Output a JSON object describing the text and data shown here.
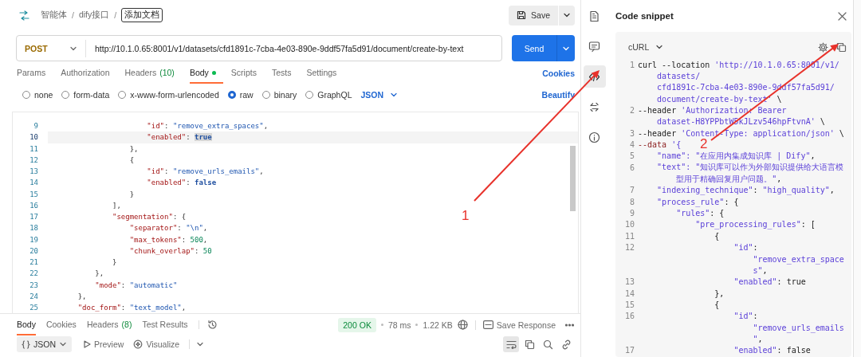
{
  "breadcrumb": [
    {
      "kind": "crumb",
      "text": "智能体"
    },
    {
      "kind": "separator",
      "text": "/"
    },
    {
      "kind": "crumb",
      "text": "dify接口"
    },
    {
      "kind": "separator",
      "text": "/"
    },
    {
      "kind": "editing",
      "text": "添加文档"
    }
  ],
  "save_button": {
    "label": "Save"
  },
  "request": {
    "method": "POST",
    "url": "http://10.1.0.65:8001/v1/datasets/cfd1891c-7cba-4e03-890e-9ddf57fa5d91/document/create-by-text",
    "send_label": "Send"
  },
  "request_tabs": [
    {
      "label": "Params",
      "selected": false,
      "indicator": false
    },
    {
      "label": "Authorization",
      "selected": false,
      "indicator": false
    },
    {
      "label": "Headers",
      "count": "(10)",
      "selected": false,
      "indicator": false
    },
    {
      "label": "Body",
      "selected": true,
      "indicator": true
    },
    {
      "label": "Scripts",
      "selected": false,
      "indicator": false
    },
    {
      "label": "Tests",
      "selected": false,
      "indicator": false
    },
    {
      "label": "Settings",
      "selected": false,
      "indicator": false
    }
  ],
  "cookies_link": "Cookies",
  "body_types": [
    {
      "label": "none",
      "selected": false
    },
    {
      "label": "form-data",
      "selected": false
    },
    {
      "label": "x-www-form-urlencoded",
      "selected": false
    },
    {
      "label": "raw",
      "selected": true
    },
    {
      "label": "binary",
      "selected": false
    },
    {
      "label": "GraphQL",
      "selected": false
    }
  ],
  "body_language": "JSON",
  "beautify_link": "Beautify",
  "editor": {
    "lines": [
      {
        "number": "9",
        "current": false,
        "tokens": [
          {
            "kind": "key",
            "text": "                    \"id\""
          },
          {
            "kind": "punct",
            "text": ": "
          },
          {
            "kind": "string",
            "text": "\"remove_extra_spaces\""
          },
          {
            "kind": "punct",
            "text": ","
          }
        ]
      },
      {
        "number": "10",
        "current": true,
        "tokens": [
          {
            "kind": "key",
            "text": "                    \"enabled\""
          },
          {
            "kind": "punct",
            "text": ": "
          },
          {
            "kind": "occurrence",
            "text": "true"
          }
        ]
      },
      {
        "number": "11",
        "current": false,
        "tokens": [
          {
            "kind": "punct",
            "text": "                },"
          }
        ]
      },
      {
        "number": "12",
        "current": false,
        "tokens": [
          {
            "kind": "punct",
            "text": "                {"
          }
        ]
      },
      {
        "number": "13",
        "current": false,
        "tokens": [
          {
            "kind": "key",
            "text": "                    \"id\""
          },
          {
            "kind": "punct",
            "text": ": "
          },
          {
            "kind": "string",
            "text": "\"remove_urls_emails\""
          },
          {
            "kind": "punct",
            "text": ","
          }
        ]
      },
      {
        "number": "14",
        "current": false,
        "tokens": [
          {
            "kind": "key",
            "text": "                    \"enabled\""
          },
          {
            "kind": "punct",
            "text": ": "
          },
          {
            "kind": "bool",
            "text": "false"
          }
        ]
      },
      {
        "number": "15",
        "current": false,
        "tokens": [
          {
            "kind": "punct",
            "text": "                }"
          }
        ]
      },
      {
        "number": "16",
        "current": false,
        "tokens": [
          {
            "kind": "punct",
            "text": "            ],"
          }
        ]
      },
      {
        "number": "17",
        "current": false,
        "tokens": [
          {
            "kind": "key",
            "text": "            \"segmentation\""
          },
          {
            "kind": "punct",
            "text": ": {"
          }
        ]
      },
      {
        "number": "18",
        "current": false,
        "tokens": [
          {
            "kind": "key",
            "text": "                \"separator\""
          },
          {
            "kind": "punct",
            "text": ": "
          },
          {
            "kind": "string",
            "text": "\"\\n\""
          },
          {
            "kind": "punct",
            "text": ","
          }
        ]
      },
      {
        "number": "19",
        "current": false,
        "tokens": [
          {
            "kind": "key",
            "text": "                \"max_tokens\""
          },
          {
            "kind": "punct",
            "text": ": "
          },
          {
            "kind": "number",
            "text": "500"
          },
          {
            "kind": "punct",
            "text": ","
          }
        ]
      },
      {
        "number": "20",
        "current": false,
        "tokens": [
          {
            "kind": "key",
            "text": "                \"chunk_overlap\""
          },
          {
            "kind": "punct",
            "text": ": "
          },
          {
            "kind": "number",
            "text": "50"
          }
        ]
      },
      {
        "number": "21",
        "current": false,
        "tokens": [
          {
            "kind": "punct",
            "text": "            }"
          }
        ]
      },
      {
        "number": "22",
        "current": false,
        "tokens": [
          {
            "kind": "punct",
            "text": "        },"
          }
        ]
      },
      {
        "number": "23",
        "current": false,
        "tokens": [
          {
            "kind": "key",
            "text": "        \"mode\""
          },
          {
            "kind": "punct",
            "text": ": "
          },
          {
            "kind": "string",
            "text": "\"automatic\""
          }
        ]
      },
      {
        "number": "24",
        "current": false,
        "tokens": [
          {
            "kind": "punct",
            "text": "    },"
          }
        ]
      },
      {
        "number": "25",
        "current": false,
        "tokens": [
          {
            "kind": "key",
            "text": "    \"doc_form\""
          },
          {
            "kind": "punct",
            "text": ": "
          },
          {
            "kind": "string",
            "text": "\"text_model\""
          },
          {
            "kind": "punct",
            "text": ","
          }
        ]
      }
    ]
  },
  "response_tabs": [
    {
      "label": "Body",
      "selected": true
    },
    {
      "label": "Cookies",
      "selected": false
    },
    {
      "label": "Headers",
      "count": "(8)",
      "selected": false
    },
    {
      "label": "Test Results",
      "selected": false
    }
  ],
  "response_status": {
    "code": "200 OK",
    "time": "78 ms",
    "size": "1.22 KB",
    "save_label": "Save Response"
  },
  "response_view": {
    "format": "JSON",
    "preview": "Preview",
    "visualize": "Visualize",
    "wrap_lines": true
  },
  "side_rail": [
    {
      "kind": "document",
      "selected": false
    },
    {
      "kind": "comment",
      "selected": false
    },
    {
      "kind": "code",
      "selected": true
    },
    {
      "kind": "sync",
      "selected": false
    },
    {
      "kind": "info",
      "selected": false
    }
  ],
  "code_snippet": {
    "title": "Code snippet",
    "language": "cURL",
    "lines": [
      {
        "number": "1",
        "rows": [
          {
            "segments": [
              {
                "kind": "plain",
                "text": "curl --location "
              },
              {
                "kind": "string",
                "text": "'http://10.1.0.65:8001/v1/"
              }
            ]
          },
          {
            "segments": [
              {
                "kind": "string",
                "text": "    datasets/"
              }
            ]
          },
          {
            "segments": [
              {
                "kind": "string",
                "text": "    cfd1891c-7cba-4e03-890e-9ddf57fa5d91/"
              }
            ]
          },
          {
            "segments": [
              {
                "kind": "string",
                "text": "    document/create-by-text'"
              },
              {
                "kind": "plain",
                "text": " \\"
              }
            ]
          }
        ]
      },
      {
        "number": "2",
        "rows": [
          {
            "segments": [
              {
                "kind": "plain",
                "text": "--header "
              },
              {
                "kind": "string",
                "text": "'Authorization: Bearer"
              }
            ]
          },
          {
            "segments": [
              {
                "kind": "string",
                "text": "    dataset-H8YPPbtW5kJLzv546hpFtvnA'"
              },
              {
                "kind": "plain",
                "text": " \\"
              }
            ]
          }
        ]
      },
      {
        "number": "3",
        "rows": [
          {
            "segments": [
              {
                "kind": "plain",
                "text": "--header "
              },
              {
                "kind": "string",
                "text": "'Content-Type: application/json'"
              },
              {
                "kind": "plain",
                "text": " \\"
              }
            ]
          }
        ]
      },
      {
        "number": "4",
        "rows": [
          {
            "segments": [
              {
                "kind": "flag",
                "text": "--data"
              },
              {
                "kind": "string",
                "text": " '{"
              }
            ]
          }
        ]
      },
      {
        "number": "5",
        "rows": [
          {
            "segments": [
              {
                "kind": "string",
                "text": "    \"name\": \"在应用内集成知识库 | Dify\""
              },
              {
                "kind": "plain",
                "text": ","
              }
            ]
          }
        ]
      },
      {
        "number": "6",
        "rows": [
          {
            "segments": [
              {
                "kind": "string",
                "text": "    \"text\": \"知识库可以作为外部知识提供给大语言模"
              }
            ]
          },
          {
            "segments": [
              {
                "kind": "string",
                "text": "        型用于精确回复用户问题。\""
              },
              {
                "kind": "plain",
                "text": ","
              }
            ]
          }
        ]
      },
      {
        "number": "7",
        "rows": [
          {
            "segments": [
              {
                "kind": "string",
                "text": "    \"indexing_technique\""
              },
              {
                "kind": "plain",
                "text": ": "
              },
              {
                "kind": "string",
                "text": "\"high_quality\""
              },
              {
                "kind": "plain",
                "text": ","
              }
            ]
          }
        ]
      },
      {
        "number": "8",
        "rows": [
          {
            "segments": [
              {
                "kind": "string",
                "text": "    \"process_rule\""
              },
              {
                "kind": "plain",
                "text": ": {"
              }
            ]
          }
        ]
      },
      {
        "number": "9",
        "rows": [
          {
            "segments": [
              {
                "kind": "string",
                "text": "        \"rules\""
              },
              {
                "kind": "plain",
                "text": ": {"
              }
            ]
          }
        ]
      },
      {
        "number": "10",
        "rows": [
          {
            "segments": [
              {
                "kind": "string",
                "text": "            \"pre_processing_rules\""
              },
              {
                "kind": "plain",
                "text": ": ["
              }
            ]
          }
        ]
      },
      {
        "number": "11",
        "rows": [
          {
            "segments": [
              {
                "kind": "plain",
                "text": "                {"
              }
            ]
          }
        ]
      },
      {
        "number": "12",
        "rows": [
          {
            "segments": [
              {
                "kind": "string",
                "text": "                    \"id\""
              },
              {
                "kind": "plain",
                "text": ":"
              }
            ]
          },
          {
            "segments": [
              {
                "kind": "string",
                "text": "                        \"remove_extra_space"
              }
            ]
          },
          {
            "segments": [
              {
                "kind": "string",
                "text": "                        s\""
              },
              {
                "kind": "plain",
                "text": ","
              }
            ]
          }
        ]
      },
      {
        "number": "13",
        "rows": [
          {
            "segments": [
              {
                "kind": "string",
                "text": "                    \"enabled\""
              },
              {
                "kind": "plain",
                "text": ": true"
              }
            ]
          }
        ]
      },
      {
        "number": "14",
        "rows": [
          {
            "segments": [
              {
                "kind": "plain",
                "text": "                },"
              }
            ]
          }
        ]
      },
      {
        "number": "15",
        "rows": [
          {
            "segments": [
              {
                "kind": "plain",
                "text": "                {"
              }
            ]
          }
        ]
      },
      {
        "number": "16",
        "rows": [
          {
            "segments": [
              {
                "kind": "string",
                "text": "                    \"id\""
              },
              {
                "kind": "plain",
                "text": ":"
              }
            ]
          },
          {
            "segments": [
              {
                "kind": "string",
                "text": "                        \"remove_urls_emails"
              }
            ]
          },
          {
            "segments": [
              {
                "kind": "string",
                "text": "                        \""
              },
              {
                "kind": "plain",
                "text": ","
              }
            ]
          }
        ]
      },
      {
        "number": "17",
        "rows": [
          {
            "segments": [
              {
                "kind": "string",
                "text": "                    \"enabled\""
              },
              {
                "kind": "plain",
                "text": ": false"
              }
            ]
          }
        ]
      }
    ]
  },
  "annotations": [
    {
      "label": "1"
    },
    {
      "label": "2"
    }
  ]
}
